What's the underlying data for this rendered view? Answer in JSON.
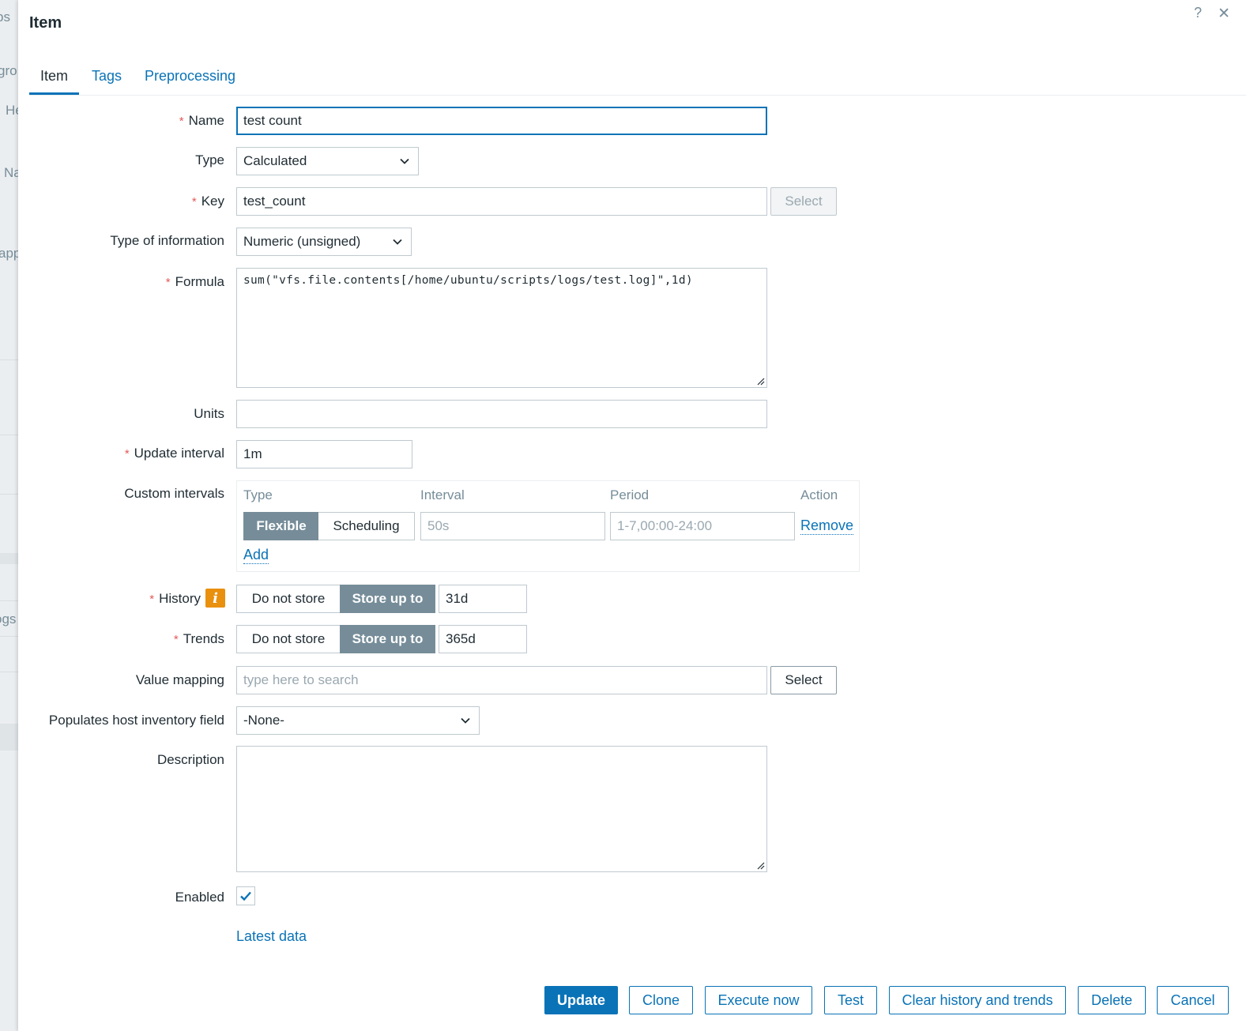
{
  "background": {
    "fragments": [
      "ps",
      "gro",
      "He",
      "Na",
      "app",
      "ogs"
    ]
  },
  "dialog": {
    "title": "Item",
    "help_icon": "?",
    "close_icon": "✕",
    "tabs": [
      {
        "label": "Item",
        "active": true
      },
      {
        "label": "Tags",
        "active": false
      },
      {
        "label": "Preprocessing",
        "active": false
      }
    ]
  },
  "form": {
    "name": {
      "label": "Name",
      "value": "test count"
    },
    "type": {
      "label": "Type",
      "value": "Calculated"
    },
    "key": {
      "label": "Key",
      "value": "test_count",
      "select_label": "Select"
    },
    "type_of_information": {
      "label": "Type of information",
      "value": "Numeric (unsigned)"
    },
    "formula": {
      "label": "Formula",
      "value": "sum(\"vfs.file.contents[/home/ubuntu/scripts/logs/test.log]\",1d)"
    },
    "units": {
      "label": "Units",
      "value": ""
    },
    "update_interval": {
      "label": "Update interval",
      "value": "1m"
    },
    "custom_intervals": {
      "label": "Custom intervals",
      "columns": [
        "Type",
        "Interval",
        "Period",
        "Action"
      ],
      "row": {
        "type_options": [
          "Flexible",
          "Scheduling"
        ],
        "selected": "Flexible",
        "interval_placeholder": "50s",
        "period_placeholder": "1-7,00:00-24:00",
        "action": "Remove"
      },
      "add_label": "Add"
    },
    "history": {
      "label": "History",
      "options": [
        "Do not store",
        "Store up to"
      ],
      "selected": "Store up to",
      "value": "31d",
      "info_icon": "i"
    },
    "trends": {
      "label": "Trends",
      "options": [
        "Do not store",
        "Store up to"
      ],
      "selected": "Store up to",
      "value": "365d"
    },
    "value_mapping": {
      "label": "Value mapping",
      "placeholder": "type here to search",
      "select_label": "Select"
    },
    "inventory_field": {
      "label": "Populates host inventory field",
      "value": "-None-"
    },
    "description": {
      "label": "Description",
      "value": ""
    },
    "enabled": {
      "label": "Enabled",
      "checked": true
    },
    "latest_data_link": "Latest data"
  },
  "footer": {
    "buttons": [
      "Update",
      "Clone",
      "Execute now",
      "Test",
      "Clear history and trends",
      "Delete",
      "Cancel"
    ]
  },
  "colors": {
    "accent": "#0a73b7",
    "required": "#e45959",
    "info": "#e9900f",
    "segment_on": "#768d99"
  }
}
